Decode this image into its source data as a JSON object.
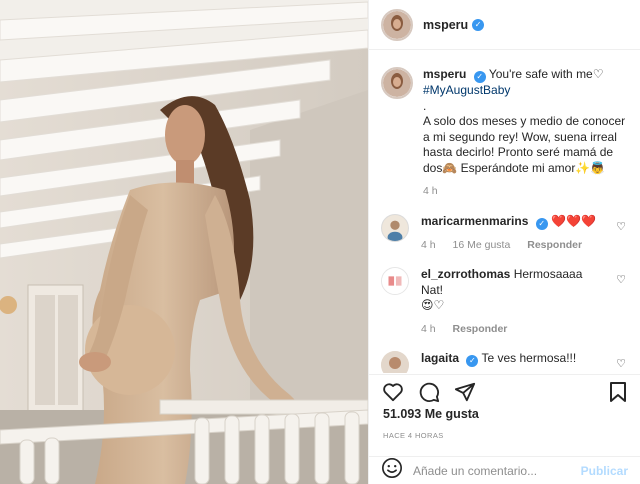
{
  "post": {
    "image_alt": "photo-of-pregnant-woman",
    "author": "msperu",
    "verified_icon": "verified-badge-icon",
    "caption": {
      "username": "msperu",
      "line1": "You're safe with me♡",
      "hashtag": "#MyAugustBaby",
      "dot": ".",
      "body": "A solo dos meses y medio de conocer a mi segundo rey! Wow, suena irreal hasta decirlo! Pronto seré mamá de dos🙈 Esperándote mi amor✨👼",
      "time": "4 h"
    },
    "comments": [
      {
        "username": "maricarmenmarins",
        "verified": true,
        "text": "❤️❤️❤️",
        "time": "4 h",
        "likes": "16 Me gusta",
        "reply": "Responder"
      },
      {
        "username": "el_zorrothomas",
        "verified": false,
        "text": "Hermosaaaa Nat!",
        "text2": "😍♡",
        "time": "4 h",
        "reply": "Responder"
      },
      {
        "username": "lagaita",
        "verified": true,
        "text": "Te ves hermosa!!!"
      }
    ],
    "likes_count": "51.093 Me gusta",
    "posted_ago": "HACE 4 HORAS",
    "comment_input": {
      "placeholder": "Añade un comentario...",
      "value": ""
    },
    "publish_label": "Publicar"
  },
  "colors": {
    "link": "#00376b",
    "verified": "#3897f0",
    "muted": "#8e8e8e",
    "publish_disabled": "#b3dbff",
    "like_red": "#e0243a"
  }
}
